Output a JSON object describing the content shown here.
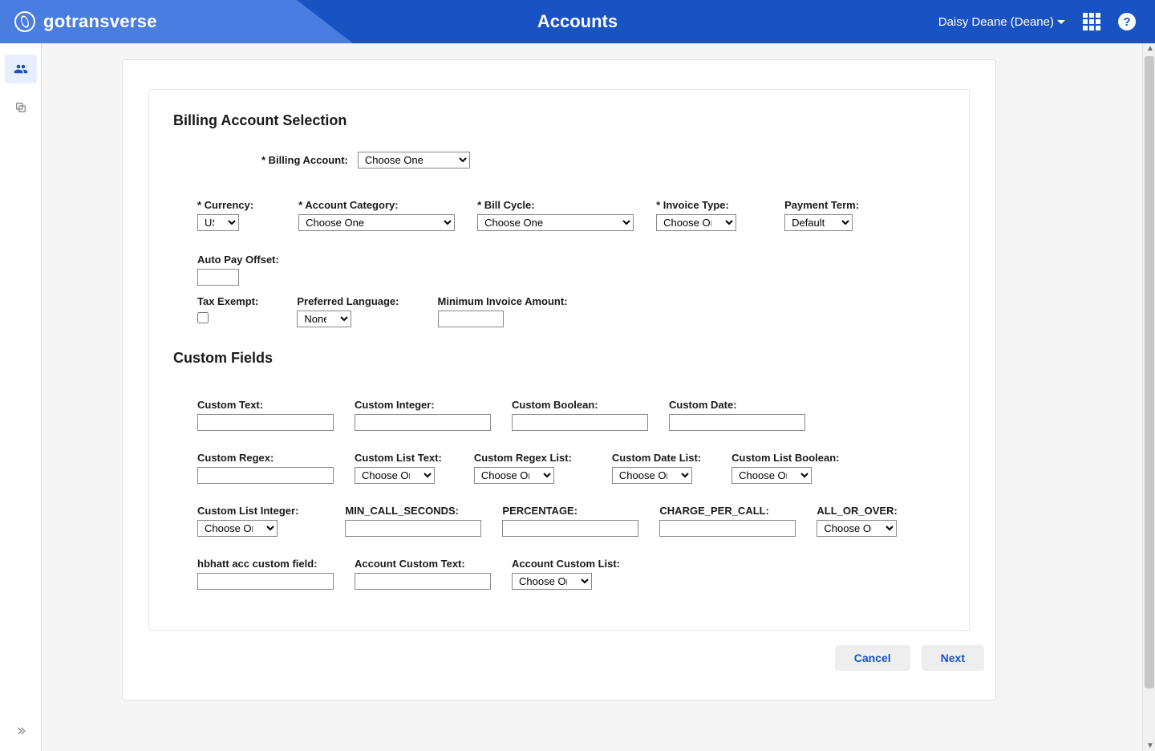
{
  "header": {
    "brand": "gotransverse",
    "title": "Accounts",
    "user": "Daisy Deane (Deane)"
  },
  "section1": {
    "title": "Billing Account Selection",
    "billing_account_label": "* Billing Account:",
    "billing_account_value": "Choose One",
    "currency_label": "* Currency:",
    "currency_value": "USD",
    "account_category_label": "* Account Category:",
    "account_category_value": "Choose One",
    "bill_cycle_label": "* Bill Cycle:",
    "bill_cycle_value": "Choose One",
    "invoice_type_label": "* Invoice Type:",
    "invoice_type_value": "Choose One",
    "payment_term_label": "Payment Term:",
    "payment_term_value": "Default",
    "auto_pay_label": "Auto Pay Offset:",
    "tax_exempt_label": "Tax Exempt:",
    "pref_lang_label": "Preferred Language:",
    "pref_lang_value": "None",
    "min_invoice_label": "Minimum Invoice Amount:"
  },
  "section2": {
    "title": "Custom Fields",
    "custom_text": "Custom Text:",
    "custom_integer": "Custom Integer:",
    "custom_boolean": "Custom Boolean:",
    "custom_date": "Custom Date:",
    "custom_regex": "Custom Regex:",
    "custom_list_text": "Custom List Text:",
    "custom_regex_list": "Custom Regex List:",
    "custom_date_list": "Custom Date List:",
    "custom_list_boolean": "Custom List Boolean:",
    "custom_list_integer": "Custom List Integer:",
    "min_call_seconds": "MIN_CALL_SECONDS:",
    "percentage": "PERCENTAGE:",
    "charge_per_call": "CHARGE_PER_CALL:",
    "all_or_over": "ALL_OR_OVER:",
    "hbhatt": "hbhatt acc custom field:",
    "account_custom_text": "Account Custom Text:",
    "account_custom_list": "Account Custom List:",
    "choose_one": "Choose One"
  },
  "buttons": {
    "cancel": "Cancel",
    "next": "Next"
  }
}
